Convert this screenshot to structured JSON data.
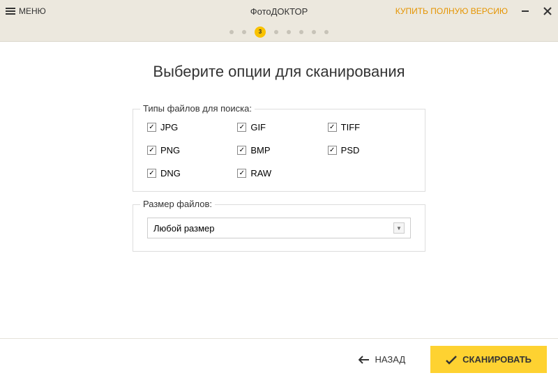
{
  "header": {
    "menu_label": "МЕНЮ",
    "app_title": "ФотоДОКТОР",
    "buy_link": "КУПИТЬ ПОЛНУЮ ВЕРСИЮ"
  },
  "wizard": {
    "total_steps": 8,
    "active_step": 3,
    "active_step_label": "3"
  },
  "main": {
    "heading": "Выберите опции для сканирования",
    "filetypes": {
      "legend": "Типы файлов для поиска:",
      "items": [
        {
          "label": "JPG",
          "checked": true
        },
        {
          "label": "GIF",
          "checked": true
        },
        {
          "label": "TIFF",
          "checked": true
        },
        {
          "label": "PNG",
          "checked": true
        },
        {
          "label": "BMP",
          "checked": true
        },
        {
          "label": "PSD",
          "checked": true
        },
        {
          "label": "DNG",
          "checked": true
        },
        {
          "label": "RAW",
          "checked": true
        }
      ]
    },
    "filesize": {
      "legend": "Размер файлов:",
      "selected": "Любой размер"
    }
  },
  "footer": {
    "back_label": "НАЗАД",
    "scan_label": "СКАНИРОВАТЬ"
  }
}
